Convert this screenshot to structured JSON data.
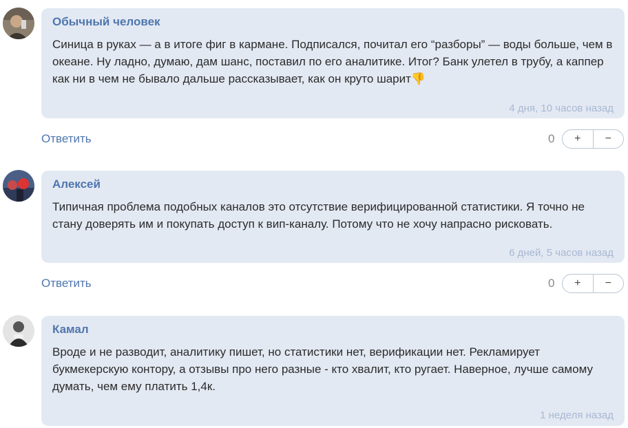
{
  "comments": [
    {
      "author": "Обычный человек",
      "text": "Синица в руках — а в итоге фиг в кармане. Подписался, почитал его “разборы” — воды больше, чем в океане. Ну ладно, думаю, дам шанс, поставил по его аналитике. Итог? Банк улетел в трубу, а каппер как ни в чем не бывало дальше рассказывает, как он круто шарит👎",
      "time": "4 дня, 10 часов назад",
      "reply_label": "Ответить",
      "score": "0",
      "plus_label": "+",
      "minus_label": "−"
    },
    {
      "author": "Алексей",
      "text": "Типичная проблема подобных каналов это отсутствие верифицированной статистики. Я точно не стану доверять им и покупать доступ к вип-каналу. Потому что не хочу напрасно рисковать.",
      "time": "6 дней, 5 часов назад",
      "reply_label": "Ответить",
      "score": "0",
      "plus_label": "+",
      "minus_label": "−"
    },
    {
      "author": "Камал",
      "text": "Вроде и не разводит, аналитику пишет, но статистики нет, верификации нет. Рекламирует букмекерскую контору, а отзывы про него разные - кто хвалит, кто ругает. Наверное, лучше самому думать, чем ему платить 1,4к.",
      "time": "1 неделя назад"
    }
  ]
}
